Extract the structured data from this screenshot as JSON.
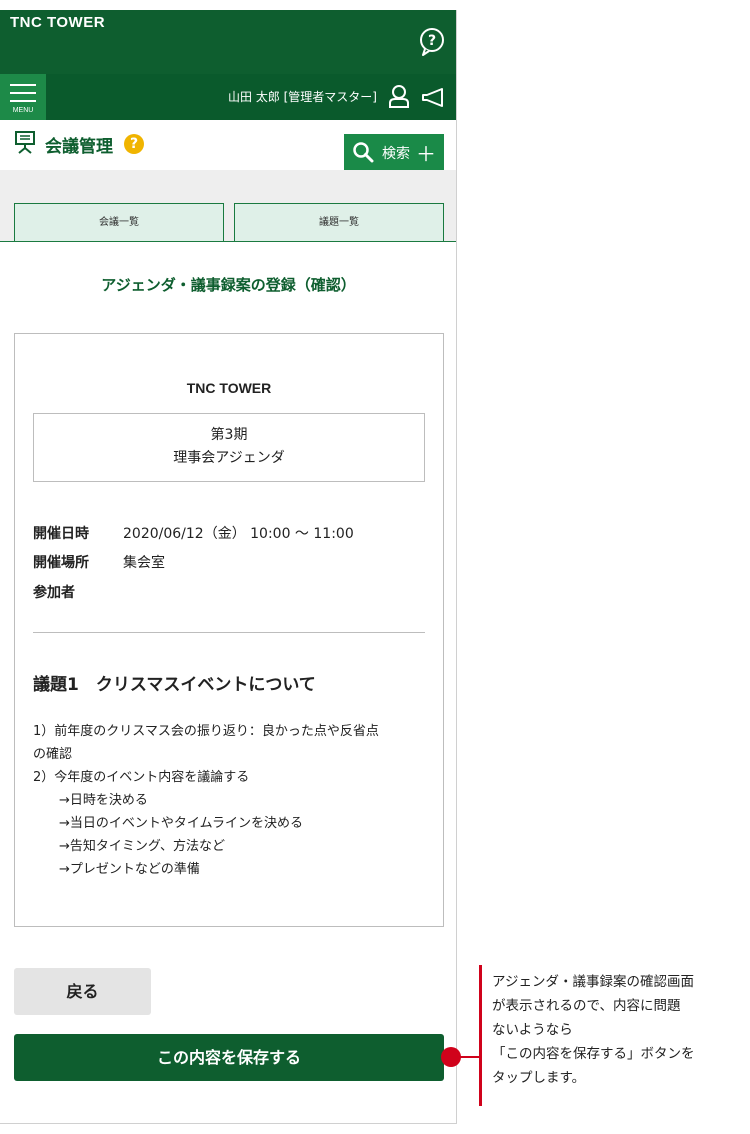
{
  "app": {
    "brand": "TNC TOWER",
    "menu_label": "MENU",
    "user_label": "山田 太郎 [管理者マスター]"
  },
  "page": {
    "title": "会議管理",
    "help_badge": "?",
    "search_label": "検索",
    "search_plus": "＋",
    "tabs": [
      {
        "label": "会議一覧"
      },
      {
        "label": "議題一覧"
      }
    ],
    "section_title": "アジェンダ・議事録案の登録（確認）"
  },
  "agenda": {
    "brand": "TNC TOWER",
    "term_line1": "第3期",
    "term_line2": "理事会アジェンダ",
    "date_label": "開催日時",
    "date_value": "2020/06/12（金） 10:00 ～ 11:00",
    "place_label": "開催場所",
    "place_value": "集会室",
    "attendee_label": "参加者",
    "topic_title": "議題1　クリスマスイベントについて",
    "topic_lines": [
      "1）前年度のクリスマス会の振り返り：良かった点や反省点",
      "の確認",
      "2）今年度のイベント内容を議論する",
      "　　→日時を決める",
      "　　→当日のイベントやタイムラインを決める",
      "　　→告知タイミング、方法など",
      "　　→プレゼントなどの準備"
    ]
  },
  "buttons": {
    "back": "戻る",
    "save": "この内容を保存する"
  },
  "callout": {
    "lines": [
      "アジェンダ・議事録案の確認画面",
      "が表示されるので、内容に問題",
      "ないようなら",
      "「この内容を保存する」ボタンを",
      "タップします。"
    ]
  },
  "colors": {
    "header_green": "#0e5e2f",
    "accent_green": "#1a8a48",
    "tab_bg": "#dff0e8",
    "help_yellow": "#f0b400",
    "callout_red": "#d0021b"
  }
}
